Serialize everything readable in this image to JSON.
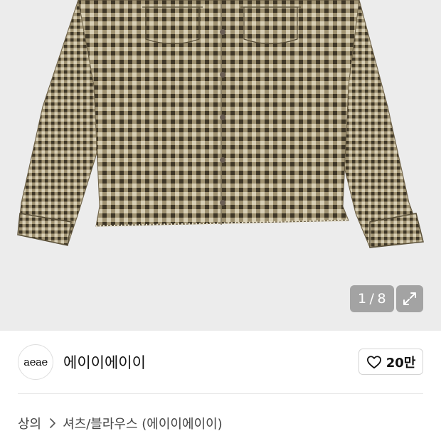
{
  "gallery": {
    "current_index": "1",
    "separator": "/",
    "total": "8",
    "product_image": "gingham-check-shirt",
    "icons": {
      "expand": "expand-arrows-icon"
    },
    "colors": {
      "check_dark": "#3f3727",
      "check_mid": "#8c7d5c",
      "check_light": "#d8cfb5",
      "background": "#ececec"
    }
  },
  "brand": {
    "logo_text": "aeae",
    "name": "에이이에이이"
  },
  "like": {
    "icon": "heart-outline-icon",
    "count": "20만"
  },
  "breadcrumb": {
    "items": [
      "상의",
      "셔츠/블라우스 (에이이에이이)"
    ],
    "separator_icon": "chevron-right-icon"
  }
}
